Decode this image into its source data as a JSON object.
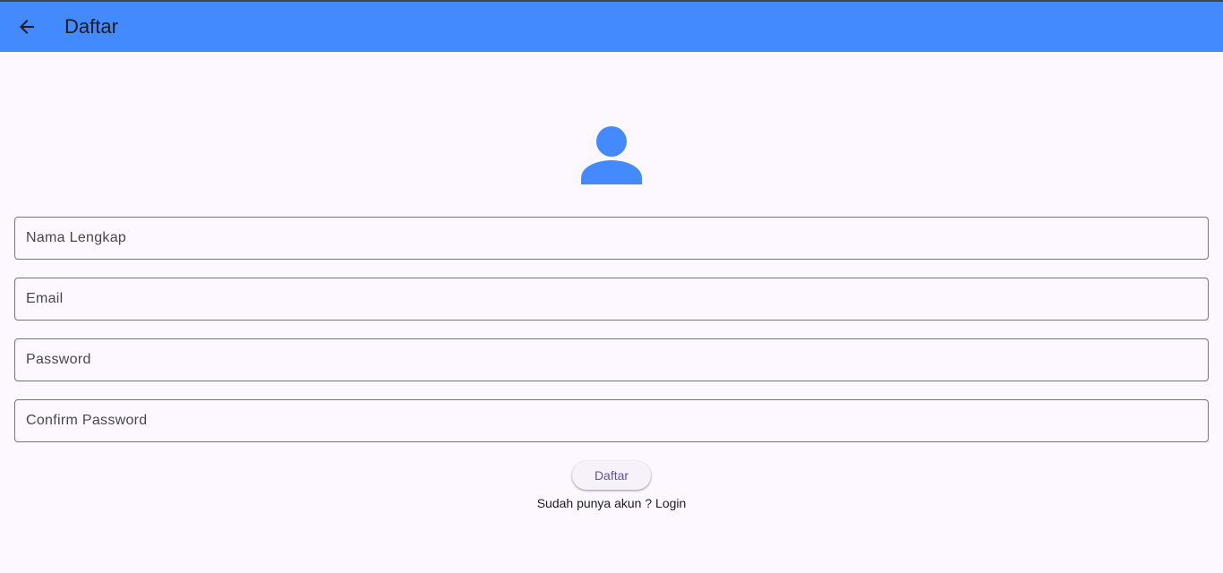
{
  "appbar": {
    "title": "Daftar",
    "back_icon": "arrow-back-icon",
    "color": "#448aff"
  },
  "avatar": {
    "icon": "person-icon",
    "color": "#448aff"
  },
  "form": {
    "full_name": {
      "placeholder": "Nama Lengkap",
      "value": ""
    },
    "email": {
      "placeholder": "Email",
      "value": ""
    },
    "password": {
      "placeholder": "Password",
      "value": ""
    },
    "confirm_password": {
      "placeholder": "Confirm Password",
      "value": ""
    }
  },
  "submit": {
    "label": "Daftar"
  },
  "login_link": {
    "text": "Sudah punya akun ? Login"
  }
}
